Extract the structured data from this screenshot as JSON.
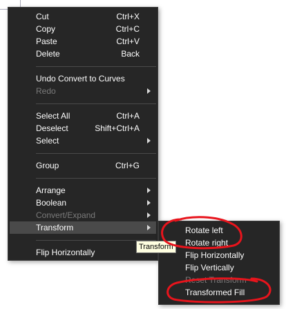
{
  "main_menu": {
    "items": [
      {
        "label": "Cut",
        "shortcut": "Ctrl+X"
      },
      {
        "label": "Copy",
        "shortcut": "Ctrl+C"
      },
      {
        "label": "Paste",
        "shortcut": "Ctrl+V"
      },
      {
        "label": "Delete",
        "shortcut": "Back"
      },
      {
        "label": "Undo Convert to Curves"
      },
      {
        "label": "Redo"
      },
      {
        "label": "Select All",
        "shortcut": "Ctrl+A"
      },
      {
        "label": "Deselect",
        "shortcut": "Shift+Ctrl+A"
      },
      {
        "label": "Select"
      },
      {
        "label": "Group",
        "shortcut": "Ctrl+G"
      },
      {
        "label": "Arrange"
      },
      {
        "label": "Boolean"
      },
      {
        "label": "Convert/Expand"
      },
      {
        "label": "Transform"
      },
      {
        "label": "Flip Horizontally"
      }
    ]
  },
  "submenu": {
    "items": [
      {
        "label": "Rotate left"
      },
      {
        "label": "Rotate right"
      },
      {
        "label": "Flip Horizontally"
      },
      {
        "label": "Flip Vertically"
      },
      {
        "label": "Reset Transform"
      },
      {
        "label": "Transformed Fill"
      }
    ]
  },
  "tooltip": {
    "text": "Transform"
  },
  "colors": {
    "menu_bg": "#262626",
    "highlight": "#4a4a4a",
    "disabled_text": "#7b7b7b",
    "annotation": "#e8141c"
  }
}
